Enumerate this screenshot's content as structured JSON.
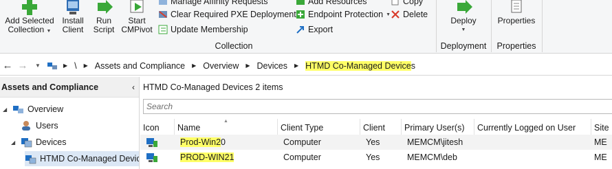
{
  "ribbon": {
    "buttons": {
      "add_selected_collection": [
        "Add Selected",
        "Collection"
      ],
      "install_client": [
        "Install",
        "Client"
      ],
      "run_script": [
        "Run",
        "Script"
      ],
      "start_cmpivot": [
        "Start",
        "CMPivot"
      ],
      "deploy": "Deploy",
      "properties": "Properties"
    },
    "small": {
      "manage_affinity": "Manage Affinity Requests",
      "clear_pxe": "Clear Required PXE Deployments",
      "update_membership": "Update Membership",
      "add_resources": "Add Resources",
      "endpoint_protection": "Endpoint Protection",
      "export": "Export",
      "copy": "Copy",
      "delete": "Delete"
    },
    "groups": {
      "collection": "Collection",
      "deployment": "Deployment",
      "properties": "Properties"
    },
    "colors": {
      "green": "#3aa839",
      "red": "#d83b2b",
      "blue": "#1f6fc4"
    }
  },
  "address": {
    "crumbs": [
      "\\",
      "Assets and Compliance",
      "Overview",
      "Devices",
      "HTMD Co-Managed Devices"
    ],
    "highlight_part": "HTMD Co-Managed Device",
    "rest_part": "s"
  },
  "left_pane": {
    "title": "Assets and Compliance",
    "tree": [
      {
        "label": "Overview",
        "icon": "overview-icon"
      },
      {
        "label": "Users",
        "icon": "user-icon"
      },
      {
        "label": "Devices",
        "icon": "devices-icon"
      },
      {
        "label": "HTMD Co-Managed Devic",
        "icon": "collection-icon"
      }
    ]
  },
  "right_pane": {
    "title": "HTMD Co-Managed Devices",
    "count": "2 items",
    "search_placeholder": "Search",
    "columns": [
      "Icon",
      "Name",
      "Client Type",
      "Client",
      "Primary User(s)",
      "Currently Logged on User",
      "Site"
    ],
    "rows": [
      {
        "name_hl": "Prod-Win2",
        "name_rest": "0",
        "client_type": "Computer",
        "client": "Yes",
        "primary_user": "MEMCM\\jitesh",
        "logged_on": "",
        "site": "ME"
      },
      {
        "name_hl": "PROD-WIN21",
        "name_rest": "",
        "client_type": "Computer",
        "client": "Yes",
        "primary_user": "MEMCM\\deb",
        "logged_on": "",
        "site": "ME"
      }
    ]
  }
}
